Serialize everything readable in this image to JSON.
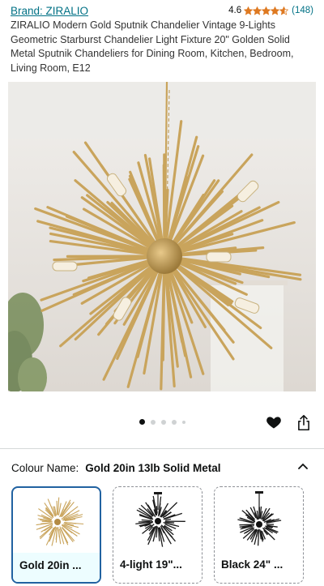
{
  "product": {
    "brand": "Brand: ZIRALIO",
    "rating": "4.6",
    "review_count": "(148)",
    "title": "ZIRALIO Modern Gold Sputnik Chandelier Vintage 9-Lights Geometric Starburst Chandelier Light Fixture 20\" Golden Solid Metal Sputnik Chandeliers for Dining Room, Kitchen, Bedroom, Living Room, E12"
  },
  "stars": {
    "count": 4.6,
    "max": 5,
    "color": "#de7921"
  },
  "gallery": {
    "total_images": 5,
    "active_index": 0
  },
  "icons": {
    "heart": "heart-icon",
    "share": "share-icon",
    "collapse": "chevron-up-icon"
  },
  "variation": {
    "label": "Colour Name:",
    "value": "Gold 20in 13lb Solid Metal"
  },
  "swatches": [
    {
      "label": "Gold 20in ...",
      "selected": true
    },
    {
      "label": "4-light 19\"...",
      "selected": false
    },
    {
      "label": "Black 24\" ...",
      "selected": false
    }
  ],
  "colors": {
    "link": "#007185",
    "accent": "#2162a1",
    "gold": "#c9a45c",
    "black": "#1a1a1a"
  }
}
